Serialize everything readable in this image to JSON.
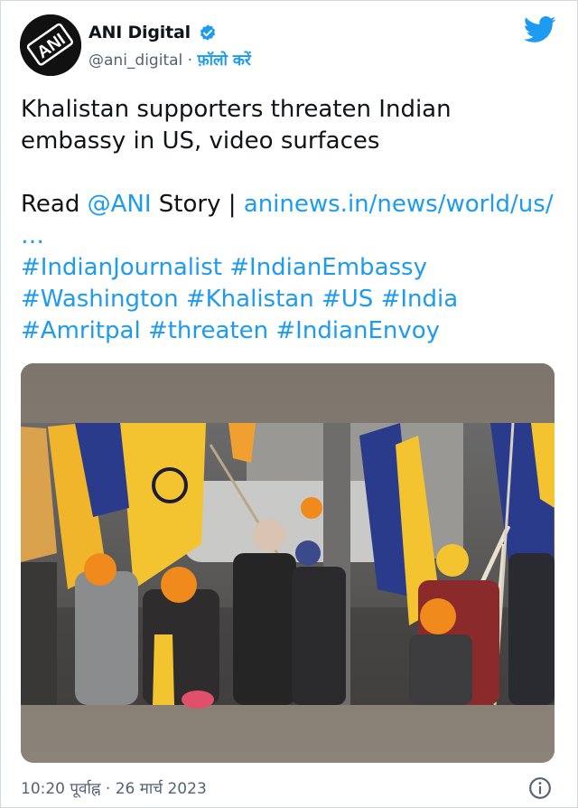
{
  "author": {
    "display_name": "ANI Digital",
    "handle": "@ani_digital",
    "separator": "·",
    "follow_label": "फ़ॉलो करें",
    "avatar_text": "ANI",
    "verified": true
  },
  "tweet": {
    "line1": "Khalistan supporters threaten Indian embassy in US, video surfaces",
    "read_prefix": "Read ",
    "mention": "@ANI",
    "story_sep": " Story | ",
    "url": "aninews.in/news/world/us/",
    "ellipsis": "…",
    "hashtags": [
      "#IndianJournalist",
      "#IndianEmbassy",
      "#Washington",
      "#Khalistan",
      "#US",
      "#India",
      "#Amritpal",
      "#threaten",
      "#IndianEnvoy"
    ]
  },
  "footer": {
    "timestamp": "10:20 पूर्वाह्न · 26 मार्च 2023"
  },
  "colors": {
    "accent": "#1d9bf0",
    "secondary_text": "#536471",
    "flag_yellow": "#f4c430",
    "flag_blue": "#2b3b8c",
    "turban_orange": "#f08a1c"
  },
  "icons": [
    "verified-badge-icon",
    "twitter-bird-icon",
    "info-icon"
  ]
}
